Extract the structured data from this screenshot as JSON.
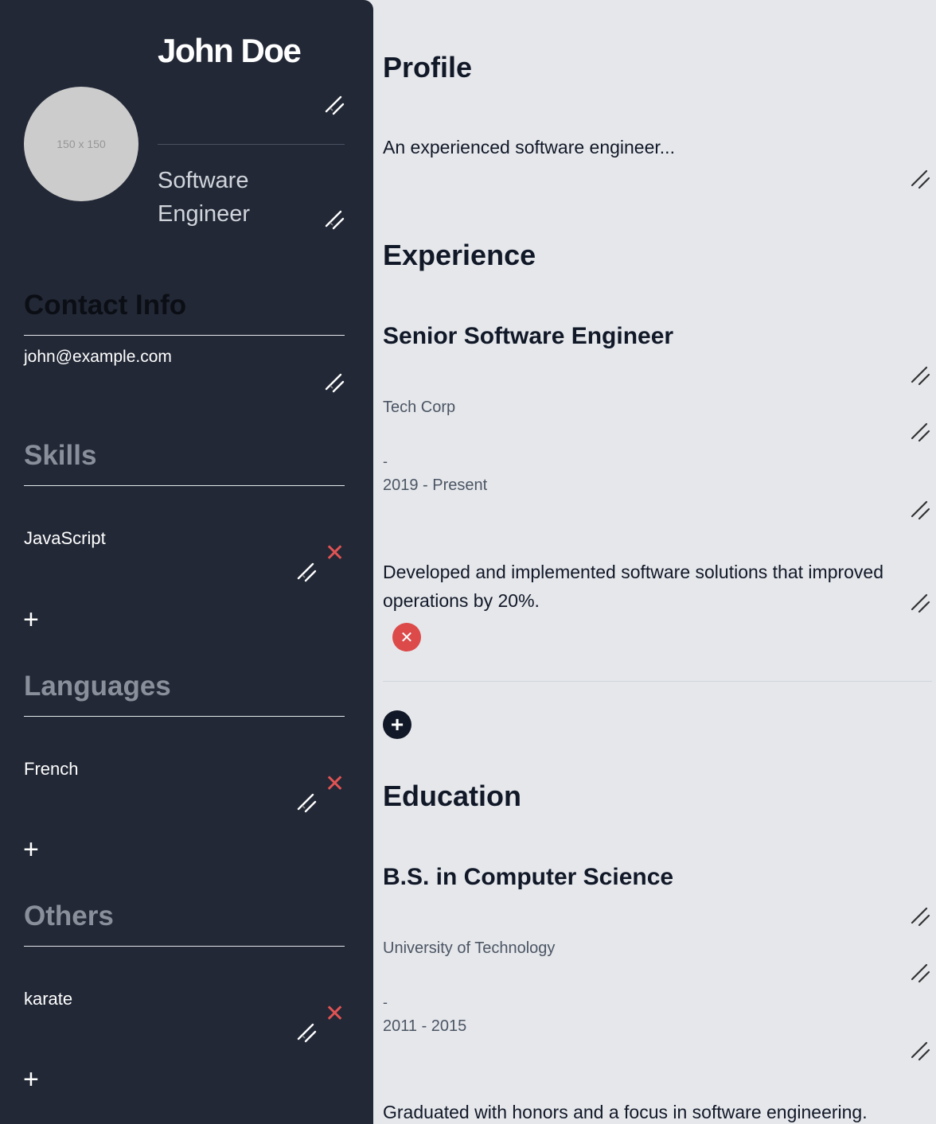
{
  "sidebar": {
    "name": "John Doe",
    "avatar_placeholder": "150 x 150",
    "title_line1": "Software",
    "title_line2": "Engineer",
    "contact": {
      "header": "Contact Info",
      "email": "john@example.com"
    },
    "skills": {
      "header": "Skills",
      "items": [
        {
          "label": "JavaScript"
        }
      ]
    },
    "languages": {
      "header": "Languages",
      "items": [
        {
          "label": "French"
        }
      ]
    },
    "others": {
      "header": "Others",
      "items": [
        {
          "label": "karate"
        }
      ]
    },
    "add_glyph": "+",
    "delete_glyph": "✕"
  },
  "main": {
    "profile": {
      "header": "Profile",
      "text": "An experienced software engineer..."
    },
    "experience": {
      "header": "Experience",
      "items": [
        {
          "title": "Senior Software Engineer",
          "company": "Tech Corp",
          "dash": "-",
          "dates": "2019 - Present",
          "description": "Developed and implemented software solutions that improved operations by 20%."
        }
      ]
    },
    "education": {
      "header": "Education",
      "items": [
        {
          "degree": "B.S. in Computer Science",
          "school": "University of Technology",
          "dash": "-",
          "dates": "2011 - 2015",
          "description": "Graduated with honors and a focus in software engineering."
        }
      ]
    },
    "add_glyph": "+",
    "delete_glyph": "✕"
  },
  "colors": {
    "sidebar_bg": "#222836",
    "main_bg": "#e5e7eb",
    "delete_red": "#e05353",
    "text_dark": "#111827"
  },
  "icons": [
    "pencil-icon",
    "close-icon",
    "plus-icon"
  ]
}
